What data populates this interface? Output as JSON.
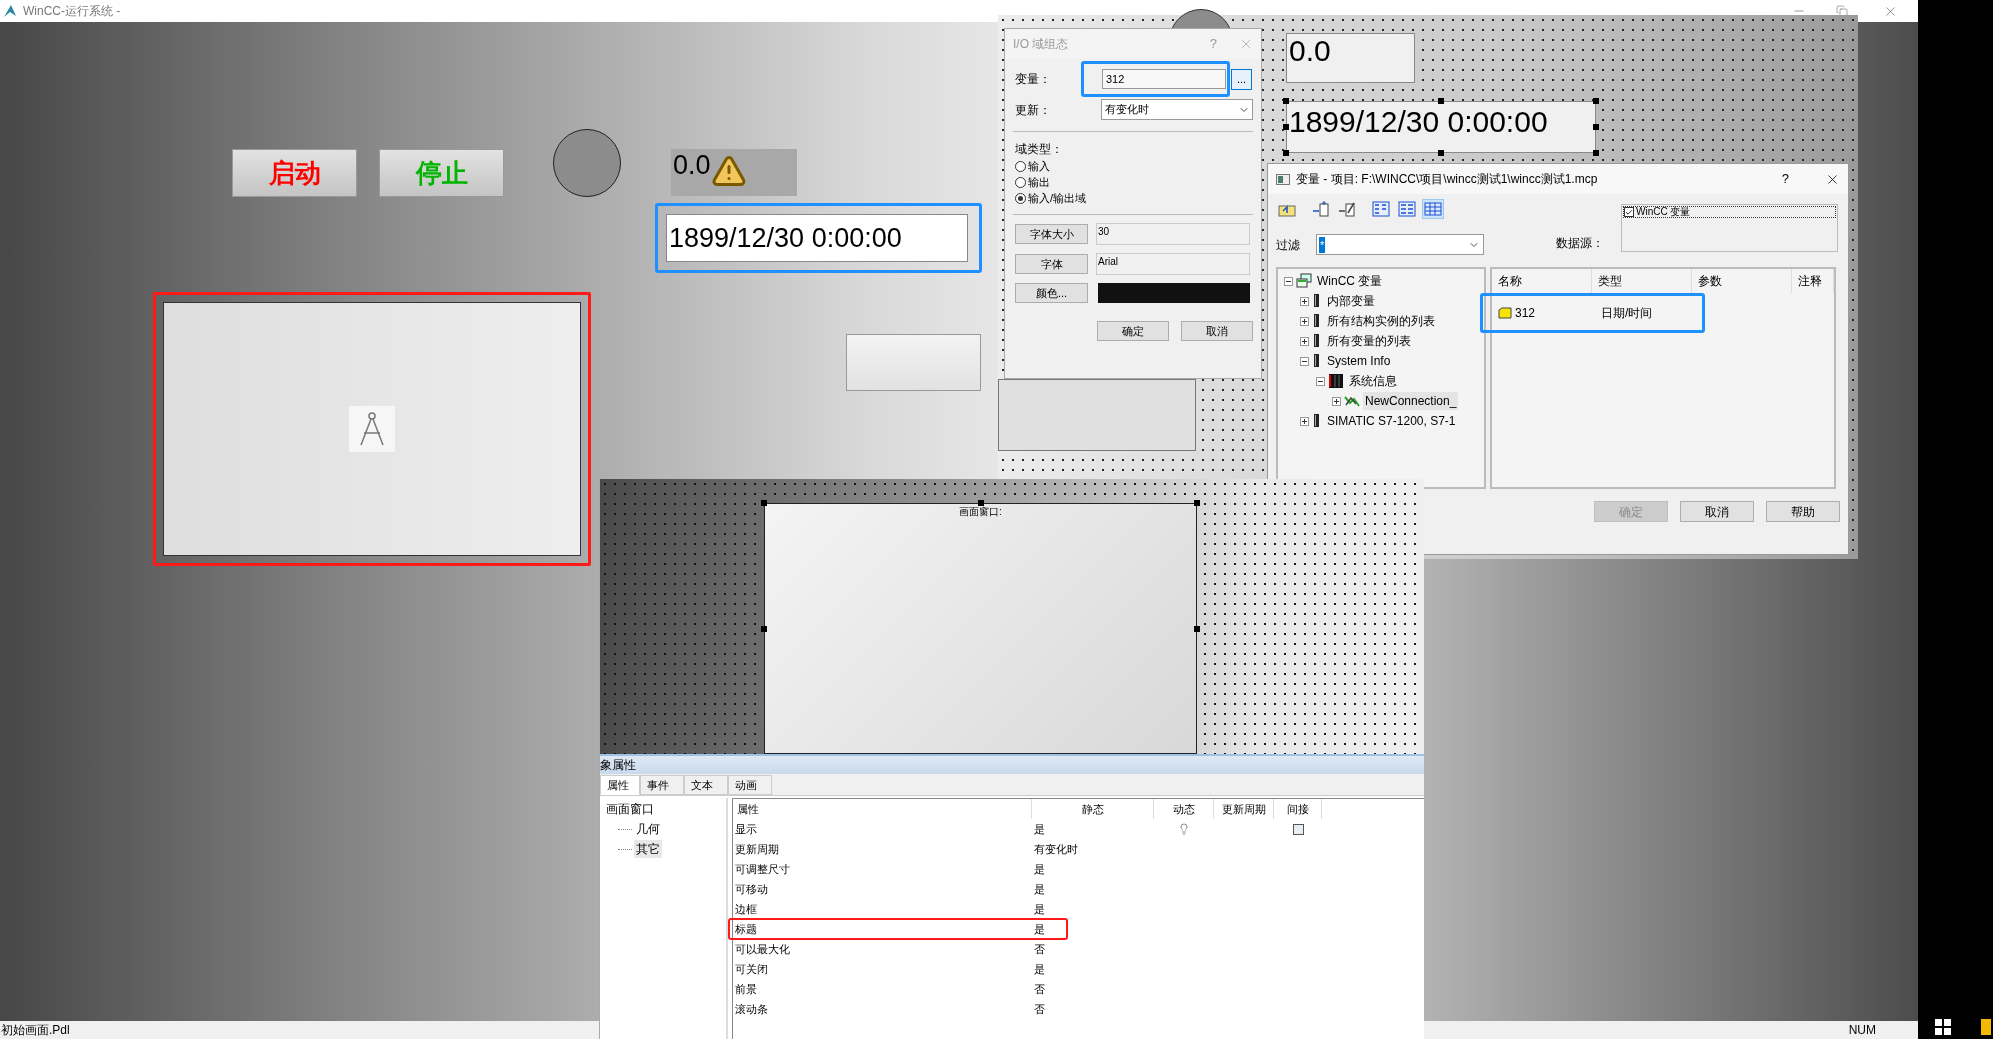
{
  "title_bar": {
    "title": "WinCC-运行系统 -"
  },
  "runtime": {
    "buttons": [
      {
        "label": "启动",
        "color": "#ff0000"
      },
      {
        "label": "停止",
        "color": "#00b400"
      }
    ],
    "io_field": {
      "value": "0.0",
      "warning": true
    },
    "datetime_field": {
      "value": "1899/12/30 0:00:00",
      "highlighted": true
    },
    "picture_window": {
      "highlighted": true
    }
  },
  "designer": {
    "io_field": {
      "value": "0.0"
    },
    "datetime_field": {
      "value": "1899/12/30 0:00:00",
      "selected": true
    }
  },
  "io_dialog": {
    "title": "I/O 域组态",
    "help": "?",
    "tag": {
      "label": "变量：",
      "value": "312",
      "highlighted": true,
      "browse": "..."
    },
    "update": {
      "label": "更新：",
      "value": "有变化时"
    },
    "field_type": {
      "label": "域类型：",
      "options": [
        {
          "label": "输入",
          "selected": false
        },
        {
          "label": "输出",
          "selected": false
        },
        {
          "label": "输入/输出域",
          "selected": true
        }
      ]
    },
    "format": [
      {
        "kind": "text",
        "button": "字体大小",
        "value": "30"
      },
      {
        "kind": "text",
        "button": "字体",
        "value": "Arial"
      },
      {
        "kind": "color",
        "button": "颜色...",
        "color": "#111111"
      }
    ],
    "buttons": [
      "确定",
      "取消"
    ]
  },
  "var_dialog": {
    "title": "变量 - 项目: F:\\WINCC\\项目\\wincc测试1\\wincc测试1.mcp",
    "help": "?",
    "toolbar": [
      {
        "kind": "folder-up",
        "selected": false
      },
      {
        "kind": "add",
        "selected": false
      },
      {
        "kind": "edit",
        "selected": false
      },
      {
        "kind": "small-icons",
        "selected": false
      },
      {
        "kind": "list",
        "selected": false
      },
      {
        "kind": "details",
        "selected": true
      }
    ],
    "filter": {
      "label": "过滤",
      "value": "*"
    },
    "data_source": {
      "label": "数据源：",
      "items": [
        {
          "label": "WinCC 变量",
          "checked": true
        }
      ]
    },
    "tree": [
      {
        "label": "WinCC 变量",
        "kind": "root",
        "expanded": true,
        "selected": false,
        "children": [
          {
            "label": "内部变量",
            "kind": "driver",
            "expanded": false,
            "selected": false
          },
          {
            "label": "所有结构实例的列表",
            "kind": "driver",
            "expanded": false,
            "selected": false
          },
          {
            "label": "所有变量的列表",
            "kind": "driver",
            "expanded": false,
            "selected": false
          },
          {
            "label": "System Info",
            "kind": "driver",
            "expanded": true,
            "selected": false,
            "children": [
              {
                "label": "系统信息",
                "kind": "unit",
                "expanded": true,
                "selected": false,
                "children": [
                  {
                    "label": "NewConnection_",
                    "kind": "connection",
                    "expanded": false,
                    "selected": true
                  }
                ]
              }
            ]
          },
          {
            "label": "SIMATIC S7-1200, S7-1",
            "kind": "driver",
            "expanded": false,
            "selected": false
          }
        ]
      }
    ],
    "table": {
      "columns": [
        "名称",
        "类型",
        "参数",
        "注释"
      ],
      "rows": [
        {
          "name": "312",
          "type": "日期/时间",
          "highlighted": true
        }
      ]
    },
    "buttons": [
      {
        "label": "确定",
        "disabled": true
      },
      {
        "label": "取消",
        "disabled": false
      },
      {
        "label": "帮助",
        "disabled": false
      }
    ]
  },
  "designer_canvas": {
    "picture_window": {
      "caption": "画面窗口:",
      "selected": true
    }
  },
  "properties": {
    "title": "象属性",
    "tabs": [
      {
        "label": "属性",
        "selected": true
      },
      {
        "label": "事件",
        "selected": false
      },
      {
        "label": "文本",
        "selected": false
      },
      {
        "label": "动画",
        "selected": false
      }
    ],
    "tree": [
      {
        "label": "画面窗口",
        "selected": false,
        "children": [
          {
            "label": "几何",
            "selected": false
          },
          {
            "label": "其它",
            "selected": true
          }
        ]
      }
    ],
    "columns": [
      "属性",
      "静态",
      "动态",
      "更新周期",
      "间接"
    ],
    "rows": [
      {
        "name": "显示",
        "static": "是",
        "kind": "dynamic",
        "indirect": false,
        "highlighted": false
      },
      {
        "name": "更新周期",
        "static": "有变化时",
        "kind": "plain",
        "highlighted": false
      },
      {
        "name": "可调整尺寸",
        "static": "是",
        "kind": "plain",
        "highlighted": false
      },
      {
        "name": "可移动",
        "static": "是",
        "kind": "plain",
        "highlighted": false
      },
      {
        "name": "边框",
        "static": "是",
        "kind": "plain",
        "highlighted": false
      },
      {
        "name": "标题",
        "static": "是",
        "kind": "plain",
        "highlighted": true
      },
      {
        "name": "可以最大化",
        "static": "否",
        "kind": "plain",
        "highlighted": false
      },
      {
        "name": "可关闭",
        "static": "是",
        "kind": "plain",
        "highlighted": false
      },
      {
        "name": "前景",
        "static": "否",
        "kind": "plain",
        "highlighted": false
      },
      {
        "name": "滚动条",
        "static": "否",
        "kind": "plain",
        "highlighted": false
      }
    ]
  },
  "status_bar": {
    "file": "初始画面.Pdl",
    "num": "NUM"
  }
}
